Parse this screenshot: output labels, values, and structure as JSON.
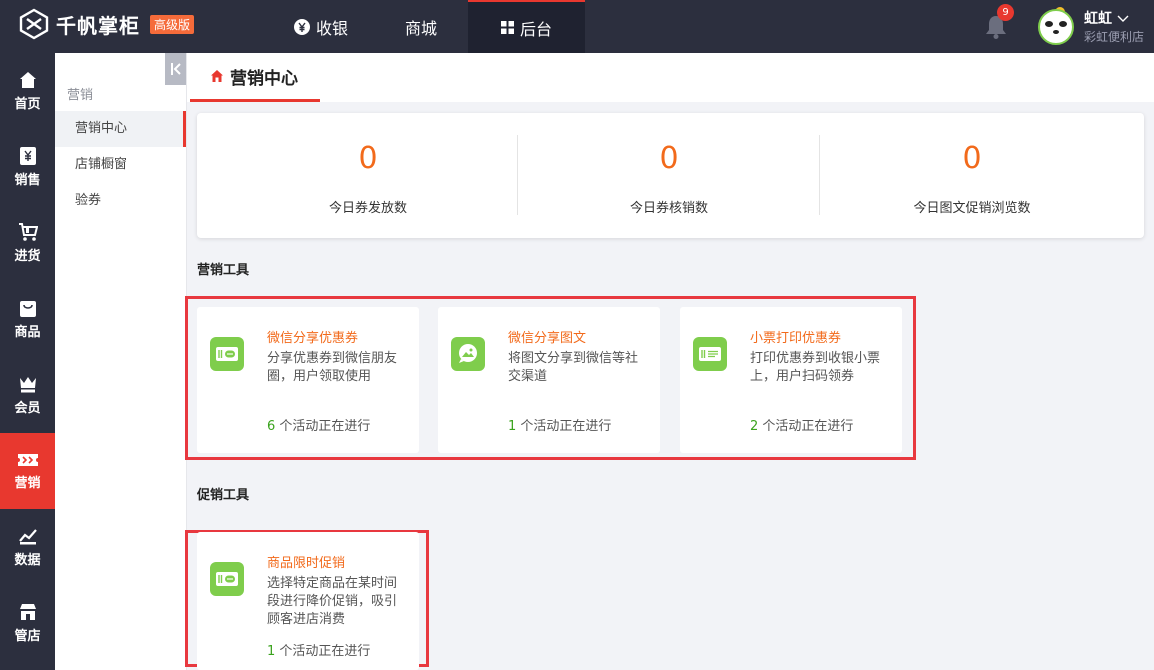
{
  "header": {
    "logo_text": "千帆掌柜",
    "edition_badge": "高级版",
    "nav": [
      {
        "label": "收银",
        "icon": "yen-icon"
      },
      {
        "label": "商城",
        "icon": ""
      },
      {
        "label": "后台",
        "icon": "grid-icon",
        "active": true
      }
    ],
    "notification_count": "9",
    "user_name": "虹虹",
    "store_name": "彩虹便利店"
  },
  "sidebar": {
    "items": [
      {
        "label": "首页",
        "icon": "home-icon"
      },
      {
        "label": "销售",
        "icon": "sales-icon"
      },
      {
        "label": "进货",
        "icon": "cart-icon"
      },
      {
        "label": "商品",
        "icon": "bag-icon"
      },
      {
        "label": "会员",
        "icon": "crown-icon"
      },
      {
        "label": "营销",
        "icon": "ticket-icon",
        "active": true
      },
      {
        "label": "数据",
        "icon": "chart-icon"
      },
      {
        "label": "管店",
        "icon": "store-icon"
      }
    ]
  },
  "submenu": {
    "title": "营销",
    "items": [
      {
        "label": "营销中心",
        "active": true
      },
      {
        "label": "店铺橱窗"
      },
      {
        "label": "验券"
      }
    ]
  },
  "page": {
    "tab_title": "营销中心"
  },
  "stats": [
    {
      "value": "0",
      "label": "今日券发放数"
    },
    {
      "value": "0",
      "label": "今日券核销数"
    },
    {
      "value": "0",
      "label": "今日图文促销浏览数"
    }
  ],
  "marketing_tools": {
    "title": "营销工具",
    "cards": [
      {
        "title": "微信分享优惠券",
        "desc": "分享优惠券到微信朋友圈，用户领取使用",
        "count": "6",
        "suffix": "个活动正在进行",
        "icon": "coupon-icon"
      },
      {
        "title": "微信分享图文",
        "desc": "将图文分享到微信等社交渠道",
        "count": "1",
        "suffix": "个活动正在进行",
        "icon": "image-share-icon"
      },
      {
        "title": "小票打印优惠券",
        "desc": "打印优惠券到收银小票上，用户扫码领券",
        "count": "2",
        "suffix": "个活动正在进行",
        "icon": "receipt-icon"
      }
    ]
  },
  "promo_tools": {
    "title": "促销工具",
    "cards": [
      {
        "title": "商品限时促销",
        "desc": "选择特定商品在某时间段进行降价促销，吸引顾客进店消费",
        "count": "1",
        "suffix": "个活动正在进行",
        "icon": "coupon-icon"
      }
    ]
  },
  "colors": {
    "accent": "#e8382f",
    "orange": "#f26a1b",
    "green": "#3aa31d",
    "icon_green": "#7fcd4c",
    "dark": "#2c2f3e"
  }
}
